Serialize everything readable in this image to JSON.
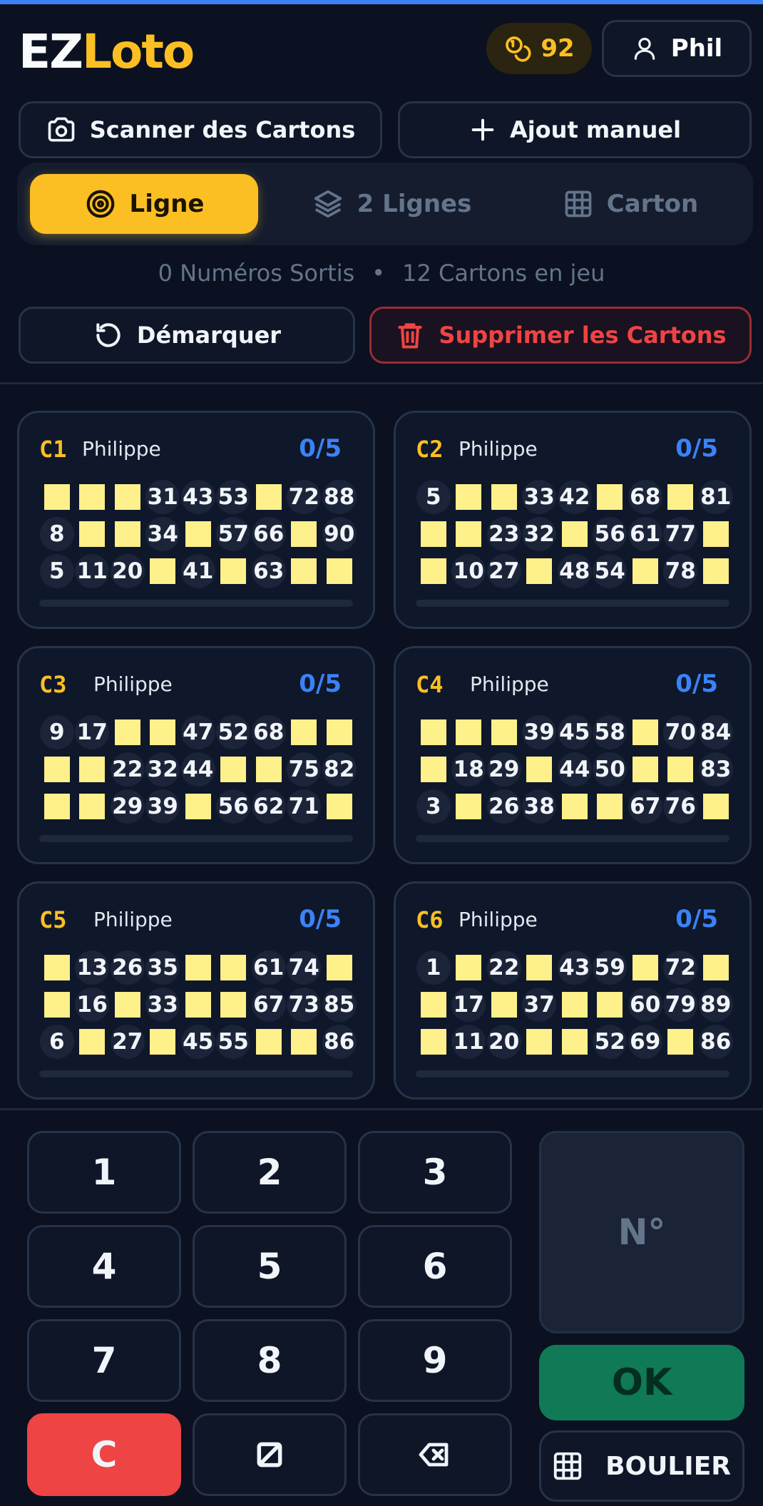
{
  "app": {
    "logo_part1": "EZ",
    "logo_part2": "Loto"
  },
  "header": {
    "coins": "92",
    "user_name": "Phil"
  },
  "actions": {
    "scan_label": "Scanner des Cartons",
    "manual_label": "Ajout manuel",
    "unmark_label": "Démarquer",
    "delete_label": "Supprimer les Cartons"
  },
  "modes": [
    {
      "label": "Ligne",
      "active": true
    },
    {
      "label": "2 Lignes",
      "active": false
    },
    {
      "label": "Carton",
      "active": false
    }
  ],
  "stats": {
    "drawn": "0 Numéros Sortis",
    "separator": "•",
    "cards": "12 Cartons en jeu"
  },
  "cards": [
    {
      "id": "C1",
      "owner": "Philippe",
      "score": "0/5",
      "progress": 0,
      "rows": [
        [
          "",
          "",
          "",
          "31",
          "43",
          "53",
          "",
          "72",
          "88"
        ],
        [
          "8",
          "",
          "",
          "34",
          "",
          "57",
          "66",
          "",
          "90"
        ],
        [
          "5",
          "11",
          "20",
          "",
          "41",
          "",
          "63",
          "",
          ""
        ]
      ]
    },
    {
      "id": "C2",
      "owner": "Philippe",
      "score": "0/5",
      "progress": 0,
      "rows": [
        [
          "5",
          "",
          "",
          "33",
          "42",
          "",
          "68",
          "",
          "81"
        ],
        [
          "",
          "",
          "23",
          "32",
          "",
          "56",
          "61",
          "77",
          ""
        ],
        [
          "",
          "10",
          "27",
          "",
          "48",
          "54",
          "",
          "78",
          ""
        ]
      ]
    },
    {
      "id": "C3",
      "owner": "Philippe",
      "score": "0/5",
      "progress": 0,
      "rows": [
        [
          "9",
          "17",
          "",
          "",
          "47",
          "52",
          "68",
          "",
          ""
        ],
        [
          "",
          "",
          "22",
          "32",
          "44",
          "",
          "",
          "75",
          "82"
        ],
        [
          "",
          "",
          "29",
          "39",
          "",
          "56",
          "62",
          "71",
          ""
        ]
      ]
    },
    {
      "id": "C4",
      "owner": "Philippe",
      "score": "0/5",
      "progress": 0,
      "rows": [
        [
          "",
          "",
          "",
          "39",
          "45",
          "58",
          "",
          "70",
          "84"
        ],
        [
          "",
          "18",
          "29",
          "",
          "44",
          "50",
          "",
          "",
          "83"
        ],
        [
          "3",
          "",
          "26",
          "38",
          "",
          "",
          "67",
          "76",
          ""
        ]
      ]
    },
    {
      "id": "C5",
      "owner": "Philippe",
      "score": "0/5",
      "progress": 0,
      "rows": [
        [
          "",
          "13",
          "26",
          "35",
          "",
          "",
          "61",
          "74",
          ""
        ],
        [
          "",
          "16",
          "",
          "33",
          "",
          "",
          "67",
          "73",
          "85"
        ],
        [
          "6",
          "",
          "27",
          "",
          "45",
          "55",
          "",
          "",
          "86"
        ]
      ]
    },
    {
      "id": "C6",
      "owner": "Philippe",
      "score": "0/5",
      "progress": 0,
      "rows": [
        [
          "1",
          "",
          "22",
          "",
          "43",
          "59",
          "",
          "72",
          ""
        ],
        [
          "",
          "17",
          "",
          "37",
          "",
          "",
          "60",
          "79",
          "89"
        ],
        [
          "",
          "11",
          "20",
          "",
          "",
          "52",
          "69",
          "",
          "86"
        ]
      ]
    }
  ],
  "keypad": {
    "keys": [
      "1",
      "2",
      "3",
      "4",
      "5",
      "6",
      "7",
      "8",
      "9"
    ],
    "clear_label": "C",
    "display_placeholder": "N°",
    "ok_label": "OK",
    "boulier_label": "BOULIER"
  },
  "colors": {
    "accent": "#fbbf24",
    "score": "#3b82f6",
    "danger": "#ef4444",
    "ok": "#0f7a55",
    "empty_cell": "#fef08a"
  }
}
